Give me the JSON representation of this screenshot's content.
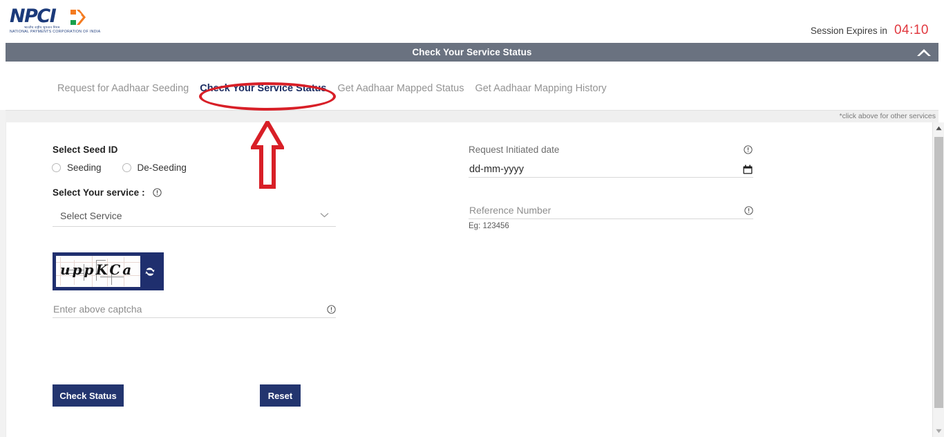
{
  "header": {
    "logo": {
      "brand": "NPCI",
      "hindi_line": "भारतीय राष्ट्रीय भुगतान निगम",
      "subtitle": "NATIONAL PAYMENTS CORPORATION OF INDIA",
      "brand_color": "#1b3a7a"
    },
    "session": {
      "label": "Session Expires in",
      "time": "04:10",
      "time_color": "#e1383f"
    }
  },
  "banner": {
    "title": "Check Your Service Status",
    "background": "#6a7280",
    "collapse_icon": "chevron-up-icon"
  },
  "tabs": {
    "items": [
      {
        "label": "Request for Aadhaar Seeding",
        "active": false
      },
      {
        "label": "Check Your Service Status",
        "active": true
      },
      {
        "label": "Get Aadhaar Mapped Status",
        "active": false
      },
      {
        "label": "Get Aadhaar Mapping History",
        "active": false
      }
    ],
    "note": "*click above for other services",
    "active_color": "#1e2f63",
    "inactive_color": "#949494"
  },
  "form": {
    "seed_id": {
      "label": "Select Seed ID",
      "options": [
        {
          "label": "Seeding",
          "selected": false
        },
        {
          "label": "De-Seeding",
          "selected": false
        }
      ]
    },
    "service": {
      "label": "Select Your service :",
      "info_icon": "info-circle-icon",
      "selected_value": "Select Service",
      "chevron_icon": "chevron-down-icon"
    },
    "captcha": {
      "text": "uppKCa",
      "refresh_icon": "refresh-icon",
      "box_color": "#1f2f6e",
      "input_placeholder": "Enter above captcha",
      "input_value": "",
      "info_icon": "info-circle-icon"
    },
    "request_date": {
      "label": "Request Initiated date",
      "value": "dd-mm-yyyy",
      "info_icon": "info-circle-icon",
      "calendar_icon": "calendar-icon"
    },
    "reference_number": {
      "placeholder": "Reference Number",
      "value": "",
      "helper": "Eg: 123456",
      "info_icon": "info-circle-icon"
    },
    "buttons": {
      "submit": "Check Status",
      "reset": "Reset",
      "color": "#23356f"
    }
  },
  "annotations": {
    "ellipse_color": "#d81f27",
    "arrow_color": "#d81f27",
    "ellipse_target": "Check Your Service Status",
    "arrow_direction": "up"
  },
  "scrollbar": {
    "up_icon": "scroll-up-arrow-icon",
    "down_icon": "scroll-down-arrow-icon"
  }
}
